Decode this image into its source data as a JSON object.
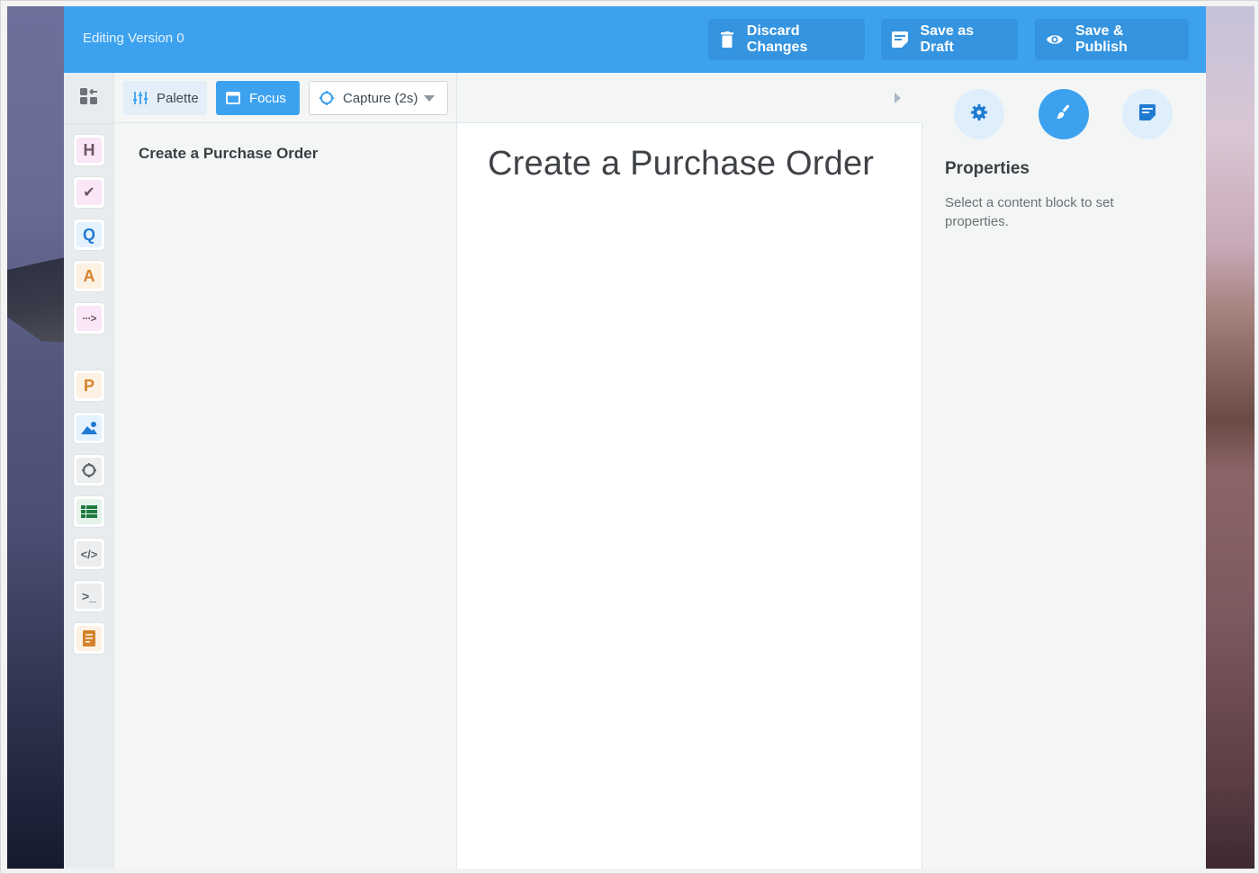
{
  "header": {
    "version_label": "Editing Version 0",
    "buttons": {
      "discard": {
        "label": "Discard Changes",
        "icon": "trash-icon"
      },
      "draft": {
        "label": "Save as Draft",
        "icon": "draft-note-icon"
      },
      "publish": {
        "label": "Save & Publish",
        "icon": "eye-icon"
      }
    },
    "accent_color": "#3ca2f0"
  },
  "rail": {
    "top_icon": "dashboard-layout-icon",
    "blocks": [
      {
        "name": "heading",
        "glyph": "H",
        "icon": "heading-icon"
      },
      {
        "name": "check",
        "glyph": "✔",
        "icon": "check-icon"
      },
      {
        "name": "question",
        "glyph": "Q",
        "icon": "question-icon"
      },
      {
        "name": "answer",
        "glyph": "A",
        "icon": "answer-icon"
      },
      {
        "name": "next-step",
        "glyph": "···>",
        "icon": "next-step-icon"
      },
      {
        "name": "paragraph",
        "glyph": "P",
        "icon": "paragraph-icon"
      },
      {
        "name": "image",
        "glyph": "",
        "icon": "image-icon"
      },
      {
        "name": "capture",
        "glyph": "",
        "icon": "capture-icon"
      },
      {
        "name": "table",
        "glyph": "",
        "icon": "table-icon"
      },
      {
        "name": "code",
        "glyph": "</>",
        "icon": "code-icon"
      },
      {
        "name": "terminal",
        "glyph": ">_",
        "icon": "terminal-icon"
      },
      {
        "name": "document",
        "glyph": "",
        "icon": "document-icon"
      }
    ]
  },
  "toolbar": {
    "palette_label": "Palette",
    "focus_label": "Focus",
    "capture_label": "Capture (2s)"
  },
  "outline": {
    "title": "Create a Purchase Order"
  },
  "editor": {
    "title": "Create a Purchase Order"
  },
  "properties": {
    "title": "Properties",
    "hint": "Select a content block to set properties.",
    "tabs": [
      {
        "name": "settings",
        "icon": "gear-icon",
        "active": false
      },
      {
        "name": "style",
        "icon": "brush-icon",
        "active": true
      },
      {
        "name": "notes",
        "icon": "notes-icon",
        "active": false
      }
    ]
  }
}
